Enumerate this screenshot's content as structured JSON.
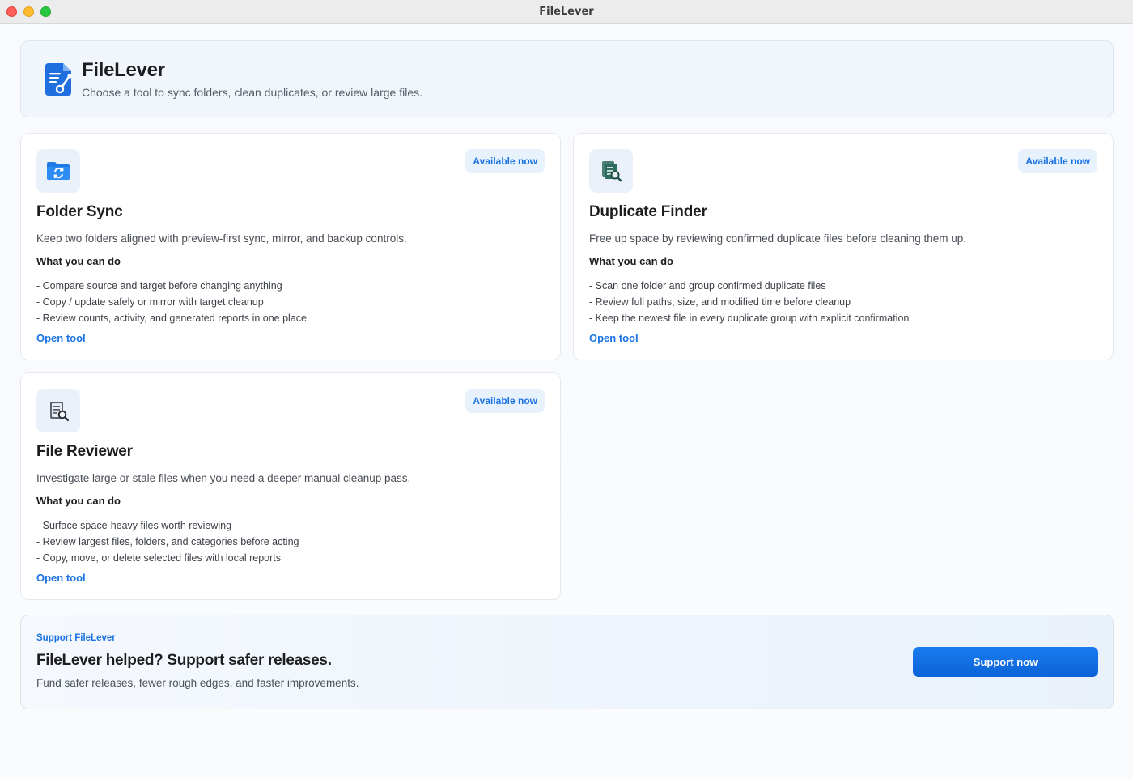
{
  "window": {
    "title": "FileLever"
  },
  "header": {
    "app_name": "FileLever",
    "subtitle": "Choose a tool to sync folders, clean duplicates, or review large files."
  },
  "tools": [
    {
      "icon": "folder-sync-icon",
      "badge": "Available now",
      "title": "Folder Sync",
      "description": "Keep two folders aligned with preview-first sync, mirror, and backup controls.",
      "what_heading": "What you can do",
      "bullets": [
        "- Compare source and target before changing anything",
        "- Copy / update safely or mirror with target cleanup",
        "- Review counts, activity, and generated reports in one place"
      ],
      "open_label": "Open tool"
    },
    {
      "icon": "duplicate-finder-icon",
      "badge": "Available now",
      "title": "Duplicate Finder",
      "description": "Free up space by reviewing confirmed duplicate files before cleaning them up.",
      "what_heading": "What you can do",
      "bullets": [
        "- Scan one folder and group confirmed duplicate files",
        "- Review full paths, size, and modified time before cleanup",
        "- Keep the newest file in every duplicate group with explicit confirmation"
      ],
      "open_label": "Open tool"
    },
    {
      "icon": "file-reviewer-icon",
      "badge": "Available now",
      "title": "File Reviewer",
      "description": "Investigate large or stale files when you need a deeper manual cleanup pass.",
      "what_heading": "What you can do",
      "bullets": [
        "- Surface space-heavy files worth reviewing",
        "- Review largest files, folders, and categories before acting",
        "- Copy, move, or delete selected files with local reports"
      ],
      "open_label": "Open tool"
    }
  ],
  "support": {
    "eyebrow": "Support FileLever",
    "title": "FileLever helped? Support safer releases.",
    "subtitle": "Fund safer releases, fewer rough edges, and faster improvements.",
    "button_label": "Support now"
  },
  "colors": {
    "accent": "#1b73e3",
    "button": "#0a6ae6",
    "card_border": "#e5e9ef"
  }
}
